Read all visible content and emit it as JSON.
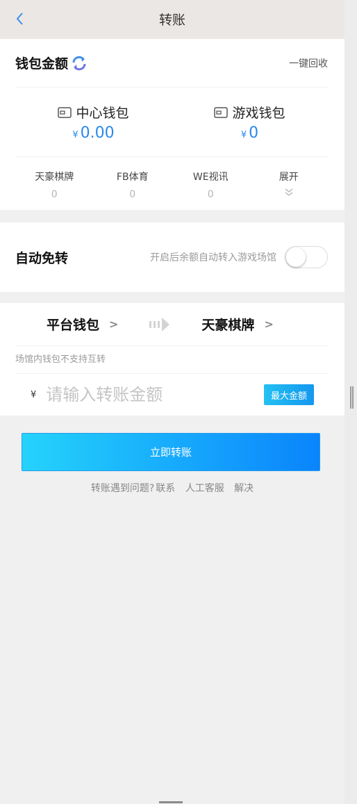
{
  "header": {
    "title": "转账"
  },
  "wallet": {
    "heading": "钱包金额",
    "recall_label": "一键回收",
    "center": {
      "name": "中心钱包",
      "currency": "¥",
      "amount": "0.00"
    },
    "game": {
      "name": "游戏钱包",
      "currency": "¥",
      "amount": "0"
    },
    "venues": [
      {
        "name": "天豪棋牌",
        "value": "0"
      },
      {
        "name": "FB体育",
        "value": "0"
      },
      {
        "name": "WE视讯",
        "value": "0"
      }
    ],
    "expand_label": "展开"
  },
  "auto_transfer": {
    "label": "自动免转",
    "hint": "开启后余额自动转入游戏场馆",
    "enabled": false
  },
  "transfer": {
    "from": "平台钱包",
    "to": "天豪棋牌",
    "note": "场馆内钱包不支持互转",
    "currency": "¥",
    "placeholder": "请输入转账金额",
    "max_label": "最大金额"
  },
  "submit_label": "立即转账",
  "help": {
    "text": "转账遇到问题?",
    "contact": "联系",
    "service": "人工客服",
    "resolve": "解决"
  },
  "colors": {
    "accent": "#2a89ea",
    "button_start": "#25d3fb",
    "button_end": "#0a84fc"
  }
}
